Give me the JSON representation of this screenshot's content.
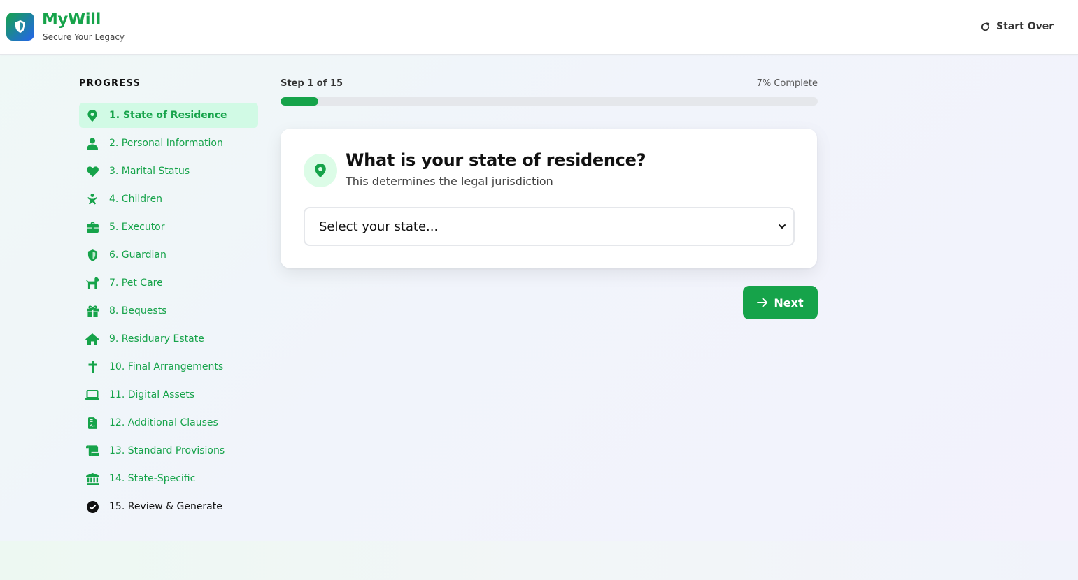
{
  "header": {
    "brand_name": "MyWill",
    "tagline": "Secure Your Legacy",
    "start_over_label": "Start Over"
  },
  "sidebar": {
    "title": "PROGRESS",
    "items": [
      {
        "label": "1. State of Residence",
        "icon": "map-pin-icon"
      },
      {
        "label": "2. Personal Information",
        "icon": "user-icon"
      },
      {
        "label": "3. Marital Status",
        "icon": "heart-icon"
      },
      {
        "label": "4. Children",
        "icon": "children-icon"
      },
      {
        "label": "5. Executor",
        "icon": "briefcase-icon"
      },
      {
        "label": "6. Guardian",
        "icon": "shield-icon"
      },
      {
        "label": "7. Pet Care",
        "icon": "dog-icon"
      },
      {
        "label": "8. Bequests",
        "icon": "gift-icon"
      },
      {
        "label": "9. Residuary Estate",
        "icon": "home-icon"
      },
      {
        "label": "10. Final Arrangements",
        "icon": "cross-icon"
      },
      {
        "label": "11. Digital Assets",
        "icon": "laptop-icon"
      },
      {
        "label": "12. Additional Clauses",
        "icon": "file-contract-icon"
      },
      {
        "label": "13. Standard Provisions",
        "icon": "scroll-icon"
      },
      {
        "label": "14. State-Specific",
        "icon": "landmark-icon"
      },
      {
        "label": "15. Review & Generate",
        "icon": "check-circle-icon"
      }
    ]
  },
  "progress": {
    "step_label": "Step 1 of 15",
    "percent_label": "7% Complete",
    "fraction": 0.07
  },
  "question": {
    "title": "What is your state of residence?",
    "subtitle": "This determines the legal jurisdiction",
    "select_value": "Select your state..."
  },
  "actions": {
    "next_label": "Next"
  },
  "colors": {
    "accent": "#16a34a",
    "active_bg": "#d1fae5"
  }
}
